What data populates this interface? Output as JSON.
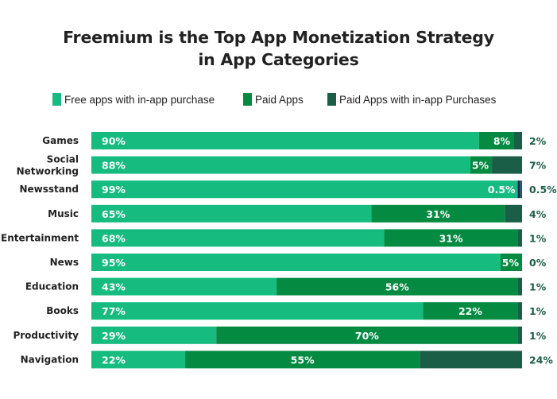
{
  "chart_data": {
    "type": "bar",
    "orientation": "horizontal",
    "stacked": true,
    "title": "Freemium is the Top App Monetization Strategy in App Categories",
    "title_lines": [
      "Freemium is the Top App Monetization Strategy",
      "in App Categories"
    ],
    "xlabel": "",
    "ylabel": "",
    "xlim": [
      0,
      100
    ],
    "grid": false,
    "legend_position": "top",
    "categories": [
      [
        "Games"
      ],
      [
        "Social",
        "Networking"
      ],
      [
        "Newsstand"
      ],
      [
        "Music"
      ],
      [
        "Entertainment"
      ],
      [
        "News"
      ],
      [
        "Education"
      ],
      [
        "Books"
      ],
      [
        "Productivity"
      ],
      [
        "Navigation"
      ]
    ],
    "series": [
      {
        "name": "Free apps with in-app purchase",
        "color": "#16BB80",
        "values": [
          90,
          88,
          99,
          65,
          68,
          95,
          43,
          77,
          29,
          22
        ],
        "labels": [
          "90%",
          "88%",
          "99%",
          "65%",
          "68%",
          "95%",
          "43%",
          "77%",
          "29%",
          "22%"
        ]
      },
      {
        "name": "Paid Apps",
        "color": "#058A42",
        "values": [
          8,
          5,
          0.5,
          31,
          31,
          5,
          56,
          22,
          70,
          55
        ],
        "labels": [
          "8%",
          "5%",
          "0.5%",
          "31%",
          "31%",
          "5%",
          "56%",
          "22%",
          "70%",
          "55%"
        ]
      },
      {
        "name": "Paid Apps with in-app Purchases",
        "color": "#1A5E48",
        "values": [
          2,
          7,
          0.5,
          4,
          1,
          0,
          1,
          1,
          1,
          24
        ],
        "labels": [
          "2%",
          "7%",
          "0.5%",
          "4%",
          "1%",
          "0%",
          "1%",
          "1%",
          "1%",
          "24%"
        ]
      }
    ],
    "notes": "Paid Apps labels appear inside the bar (right-aligned when narrow, centered when wide); Newsstand's Paid Apps segment is a thin navy sliver with its 0.5% label placed left of it; the third-series value is printed to the right of each bar."
  },
  "colors": {
    "title": "#222222",
    "category_label": "#222222",
    "outside_label": "#1A5E48",
    "inside_label": "#FFFFFF",
    "sliver": "#1A1A6E"
  }
}
